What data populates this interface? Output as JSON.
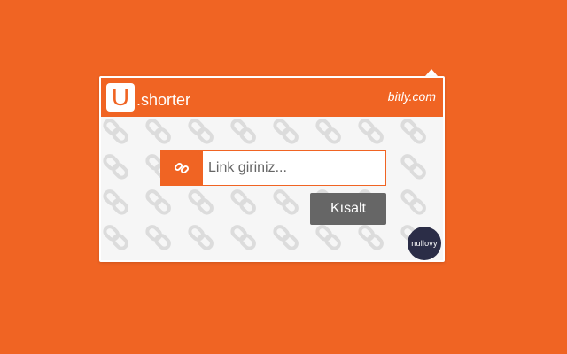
{
  "app": {
    "logo_letter": "U",
    "name": ".shorter",
    "provider": "bitly.com"
  },
  "form": {
    "link_icon": "link-icon",
    "url_placeholder": "Link giriniz...",
    "url_value": "",
    "shorten_label": "Kısalt"
  },
  "badge": {
    "text": "nullovy"
  },
  "colors": {
    "accent": "#f06423",
    "button": "#666666",
    "badge": "#2b2d47",
    "panel_bg": "#f6f6f6"
  }
}
